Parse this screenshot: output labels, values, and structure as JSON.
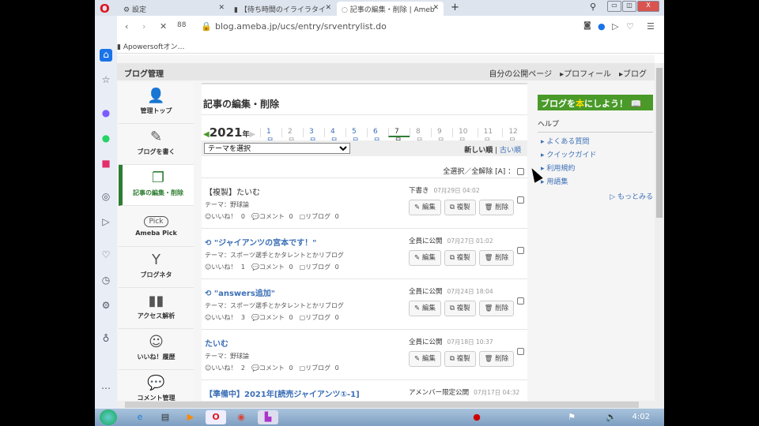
{
  "browser": {
    "tabs": [
      {
        "label": "設定"
      },
      {
        "label": "【待ち時間のイライラタイ"
      },
      {
        "label": "記事の編集・削除 | Ameb"
      }
    ],
    "url": "blog.ameba.jp/ucs/entry/srventrylist.do",
    "bookmark": "Apowersoftオン…"
  },
  "header": {
    "title": "ブログ管理",
    "links": [
      "自分の公開ページ",
      "プロフィール",
      "ブログ"
    ]
  },
  "nav": [
    {
      "label": "管理トップ",
      "icon": "person-icon"
    },
    {
      "label": "ブログを書く",
      "icon": "pencil-icon"
    },
    {
      "label": "記事の編集・削除",
      "icon": "folders-icon"
    },
    {
      "label": "Ameba Pick",
      "icon": "pick-icon"
    },
    {
      "label": "ブログネタ",
      "icon": "sprout-icon"
    },
    {
      "label": "アクセス解析",
      "icon": "bars-icon"
    },
    {
      "label": "いいね！履歴",
      "icon": "smile-icon"
    },
    {
      "label": "コメント管理",
      "icon": "chat-icon"
    }
  ],
  "main": {
    "title": "記事の編集・削除",
    "year": "2021",
    "year_suffix": "年",
    "months": [
      "1月",
      "2月",
      "3月",
      "4月",
      "5月",
      "6月",
      "7月",
      "8月",
      "9月",
      "10月",
      "11月",
      "12月"
    ],
    "selected_month": "7月",
    "theme_select": "テーマを選択",
    "sort_new": "新しい順",
    "sort_old": "古い順",
    "select_all": "全選択／全解除 [A] ：",
    "buttons": {
      "edit": "✎ 編集",
      "copy": "⧉ 複製",
      "delete": "🗑 削除"
    },
    "entries": [
      {
        "title": "【複製】たいむ",
        "theme": "テーマ：野球論",
        "stats": "☺いいね！ 0　💬コメント 0　▢リブログ 0",
        "status": "下書き",
        "date": "07月29日 04:02"
      },
      {
        "title": "⟲ \"ジャイアンツの宮本です！\"",
        "theme": "テーマ：スポーツ選手とかタレントとかリブログ",
        "stats": "☺いいね！ 1　💬コメント 0　▢リブログ 0",
        "status": "全員に公開",
        "date": "07月27日 01:02"
      },
      {
        "title": "⟲ \"answers追加\"",
        "theme": "テーマ：スポーツ選手とかタレントとかリブログ",
        "stats": "☺いいね！ 3　💬コメント 0　▢リブログ 0",
        "status": "全員に公開",
        "date": "07月24日 18:04"
      },
      {
        "title": "たいむ",
        "theme": "テーマ：野球論",
        "stats": "☺いいね！ 2　💬コメント 0　▢リブログ 0",
        "status": "全員に公開",
        "date": "07月18日 10:37"
      },
      {
        "title": "【準備中】2021年[読売ジャイアンツ①-1]",
        "status": "アメンバー限定公開",
        "date": "07月17日 04:32"
      }
    ]
  },
  "right": {
    "banner_a": "ブログを",
    "banner_b": "本",
    "banner_c": "にしよう！",
    "help_title": "ヘルプ",
    "help_links": [
      "よくある質問",
      "クイックガイド",
      "利用規約",
      "用語集"
    ],
    "more": "もっとみる"
  },
  "taskbar": {
    "clock": "4:02"
  }
}
